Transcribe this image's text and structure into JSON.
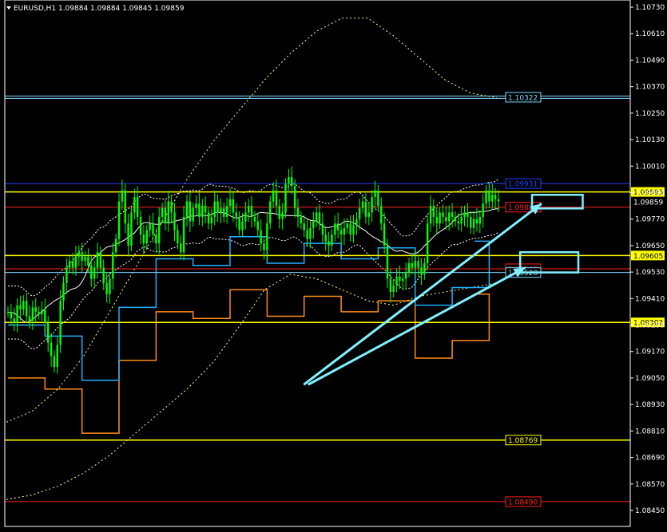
{
  "header": {
    "symbol_text": "EURUSD,H1  1.09884 1.09884 1.09845 1.09859",
    "triangle": "triangle-down-icon"
  },
  "colors": {
    "background": "#000000",
    "frame": "#ffffff",
    "candle": "#00ff00",
    "grid_none": true,
    "yellow_level": "#ffff00",
    "yellow_dashed": "#f0e060",
    "cyan_level": "#7fd8ff",
    "blue_level": "#2040ff",
    "red_level": "#ff2020",
    "orange_stop": "#ff8c1a",
    "cyan_stop": "#20b0ff",
    "arrow": "#7ff0ff",
    "bollinger_outer": "#ffff80",
    "bollinger_inner": "#ffffff"
  },
  "chart_data": {
    "type": "candlestick",
    "symbol": "EURUSD",
    "timeframe": "H1",
    "ohlc_last": {
      "open": 1.09884,
      "high": 1.09884,
      "low": 1.09845,
      "close": 1.09859
    },
    "ylim": [
      1.0842,
      1.0875
    ],
    "y_ticks": [
      "1.10730",
      "1.10610",
      "1.10490",
      "1.10370",
      "1.10250",
      "1.10130",
      "1.10010",
      "1.09890",
      "1.09770",
      "1.09650",
      "1.09530",
      "1.09410",
      "1.09290",
      "1.09170",
      "1.09050",
      "1.08930",
      "1.08810",
      "1.08690",
      "1.08570",
      "1.08450"
    ],
    "y_tick_values": [
      1.1073,
      1.1061,
      1.1049,
      1.1037,
      1.1025,
      1.1013,
      1.1001,
      1.0989,
      1.0977,
      1.0965,
      1.0953,
      1.0941,
      1.0929,
      1.0917,
      1.0905,
      1.0893,
      1.0881,
      1.0869,
      1.0857,
      1.0845
    ],
    "current_price": {
      "label": "1.09859",
      "value": 1.09859
    },
    "levels": [
      {
        "label": "1.10322",
        "value": 1.10322,
        "color": "#7fd8ff",
        "style": "double"
      },
      {
        "label": "1.09931",
        "value": 1.09931,
        "color": "#2040ff",
        "style": "solid"
      },
      {
        "label": "1.09893",
        "value": 1.09893,
        "color": "#ffff00",
        "style": "solid"
      },
      {
        "label": "1.09824",
        "value": 1.09824,
        "color": "#ff2020",
        "style": "solid"
      },
      {
        "label": "1.09605",
        "value": 1.09605,
        "color": "#ffff00",
        "style": "solid"
      },
      {
        "label": "1.09545",
        "value": 1.09545,
        "color": "#ff2020",
        "style": "solid"
      },
      {
        "label": "1.09528",
        "value": 1.09528,
        "color": "#7fd8ff",
        "style": "solid"
      },
      {
        "label": "1.09302",
        "value": 1.09302,
        "color": "#ffff00",
        "style": "solid"
      },
      {
        "label": "1.08769",
        "value": 1.08769,
        "color": "#ffff00",
        "style": "solid"
      },
      {
        "label": "1.08490",
        "value": 1.0849,
        "color": "#ff2020",
        "style": "solid"
      }
    ],
    "series": [
      {
        "kind": "close",
        "values": [
          1.0935,
          1.0932,
          1.093,
          1.0938,
          1.0936,
          1.094,
          1.0933,
          1.0931,
          1.0937,
          1.0935,
          1.0934,
          1.0936,
          1.093,
          1.0921,
          1.0915,
          1.091,
          1.092,
          1.094,
          1.0948,
          1.0955,
          1.0958,
          1.0955,
          1.096,
          1.0962,
          1.0958,
          1.096,
          1.0956,
          1.095,
          1.0955,
          1.0962,
          1.0955,
          1.0948,
          1.0943,
          1.095,
          1.0962,
          1.0968,
          1.0985,
          1.099,
          1.0975,
          1.0965,
          1.098,
          1.0987,
          1.0978,
          1.097,
          1.0966,
          1.0972,
          1.0975,
          1.097,
          1.0966,
          1.0978,
          1.0982,
          1.0975,
          1.0985,
          1.098,
          1.0972,
          1.0966,
          1.0962,
          1.0978,
          1.0985,
          1.0976,
          1.0982,
          1.0984,
          1.0978,
          1.0983,
          1.098,
          1.0975,
          1.0978,
          1.0985,
          1.098,
          1.0982,
          1.0978,
          1.0983,
          1.0986,
          1.098,
          1.0978,
          1.0972,
          1.0976,
          1.098,
          1.0983,
          1.0978,
          1.0976,
          1.0972,
          1.0966,
          1.0963,
          1.0975,
          1.0985,
          1.099,
          1.0983,
          1.0977,
          1.098,
          1.0993,
          1.0996,
          1.0992,
          1.0982,
          1.0978,
          1.0975,
          1.0972,
          1.0968,
          1.0973,
          1.0976,
          1.098,
          1.0975,
          1.097,
          1.0967,
          1.0965,
          1.097,
          1.0975,
          1.0972,
          1.097,
          1.0973,
          1.0975,
          1.097,
          1.0974,
          1.0977,
          1.0982,
          1.0985,
          1.0978,
          1.098,
          1.0987,
          1.099,
          1.0983,
          1.0975,
          1.0965,
          1.095,
          1.0944,
          1.0947,
          1.0951,
          1.0949,
          1.095,
          1.0953,
          1.0957,
          1.0955,
          1.0958,
          1.0955,
          1.0952,
          1.0957,
          1.0975,
          1.0983,
          1.0978,
          1.0975,
          1.098,
          1.0978,
          1.0976,
          1.098,
          1.0978,
          1.0976,
          1.0975,
          1.0978,
          1.098,
          1.0978,
          1.0973,
          1.0977,
          1.0975,
          1.0978,
          1.0984,
          1.099,
          1.0985,
          1.0988,
          1.0986,
          1.0985
        ]
      }
    ],
    "bollinger_upper_wide": [
      1.0885,
      1.089,
      1.09,
      1.0915,
      1.0935,
      1.0955,
      1.0975,
      1.0995,
      1.1012,
      1.1026,
      1.104,
      1.1052,
      1.1062,
      1.1068,
      1.1068,
      1.106,
      1.105,
      1.104,
      1.1034,
      1.1032
    ],
    "bollinger_lower_wide": [
      1.085,
      1.0852,
      1.0856,
      1.0862,
      1.087,
      1.088,
      1.089,
      1.09,
      1.0912,
      1.0928,
      1.0945,
      1.0952,
      1.095,
      1.0945,
      1.094,
      1.0938,
      1.0942,
      1.0944,
      1.0946,
      1.0948
    ],
    "annotations": [
      {
        "type": "arrow",
        "from": [
          0.478,
          1.0902
        ],
        "to": [
          0.858,
          1.0984
        ],
        "color": "#7ff0ff"
      },
      {
        "type": "arrow",
        "from": [
          0.485,
          1.0902
        ],
        "to": [
          0.832,
          1.0955
        ],
        "color": "#7ff0ff"
      },
      {
        "type": "rect",
        "x0": 0.843,
        "x1": 0.924,
        "y0": 1.0988,
        "y1": 1.0984,
        "color": "#7ff0ff"
      },
      {
        "type": "rect",
        "x0": 0.824,
        "x1": 0.917,
        "y0": 1.0962,
        "y1": 1.0955,
        "color": "#7ff0ff"
      }
    ]
  }
}
